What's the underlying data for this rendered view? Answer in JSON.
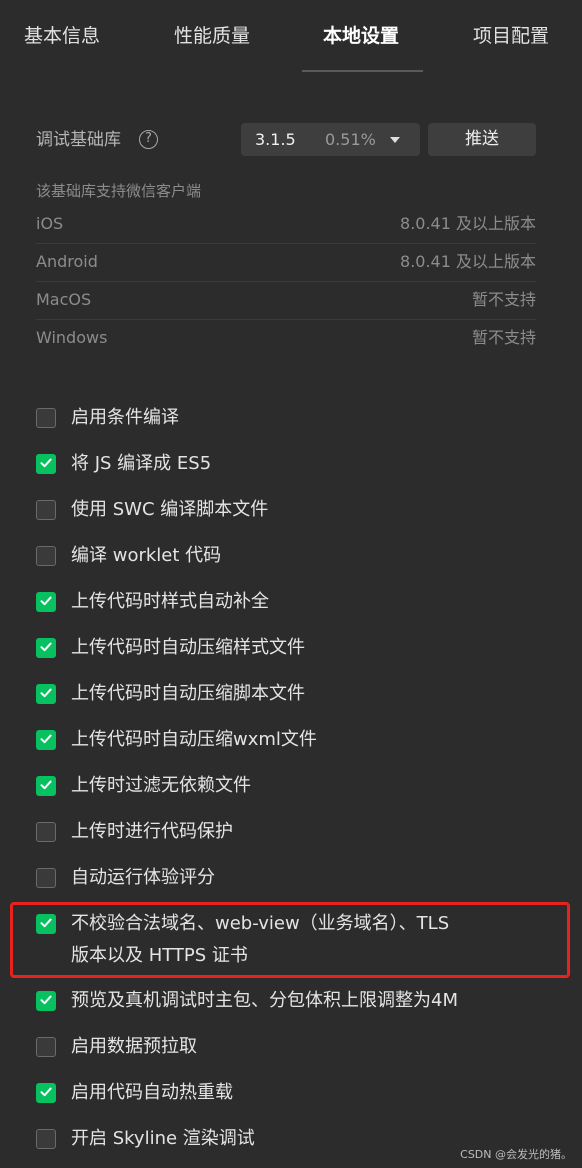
{
  "tabs": [
    {
      "label": "基本信息",
      "active": false
    },
    {
      "label": "性能质量",
      "active": false
    },
    {
      "label": "本地设置",
      "active": true
    },
    {
      "label": "项目配置",
      "active": false
    }
  ],
  "debug_lib": {
    "label": "调试基础库",
    "help_icon": "question-circle-icon",
    "version": "3.1.5",
    "percent": "0.51%",
    "push_label": "推送"
  },
  "support": {
    "heading": "该基础库支持微信客户端",
    "rows": [
      {
        "platform": "iOS",
        "value": "8.0.41 及以上版本"
      },
      {
        "platform": "Android",
        "value": "8.0.41 及以上版本"
      },
      {
        "platform": "MacOS",
        "value": "暂不支持"
      },
      {
        "platform": "Windows",
        "value": "暂不支持"
      }
    ]
  },
  "options": [
    {
      "label": "启用条件编译",
      "checked": false
    },
    {
      "label": "将 JS 编译成 ES5",
      "checked": true
    },
    {
      "label": "使用 SWC 编译脚本文件",
      "checked": false
    },
    {
      "label": "编译 worklet 代码",
      "checked": false
    },
    {
      "label": "上传代码时样式自动补全",
      "checked": true
    },
    {
      "label": "上传代码时自动压缩样式文件",
      "checked": true
    },
    {
      "label": "上传代码时自动压缩脚本文件",
      "checked": true
    },
    {
      "label": "上传代码时自动压缩wxml文件",
      "checked": true
    },
    {
      "label": "上传时过滤无依赖文件",
      "checked": true
    },
    {
      "label": "上传时进行代码保护",
      "checked": false
    },
    {
      "label": "自动运行体验评分",
      "checked": false
    },
    {
      "label": "不校验合法域名、web-view（业务域名）、TLS",
      "label_line2": "版本以及 HTTPS 证书",
      "checked": true,
      "highlighted": true
    },
    {
      "label": "预览及真机调试时主包、分包体积上限调整为4M",
      "checked": true
    },
    {
      "label": "启用数据预拉取",
      "checked": false
    },
    {
      "label": "启用代码自动热重载",
      "checked": true
    },
    {
      "label": "开启 Skyline 渲染调试",
      "checked": false
    }
  ],
  "colors": {
    "background": "#2c2c2c",
    "checkbox_checked": "#07c160",
    "highlight_border": "#e8231d"
  },
  "watermark": "CSDN @会发光的猪。"
}
